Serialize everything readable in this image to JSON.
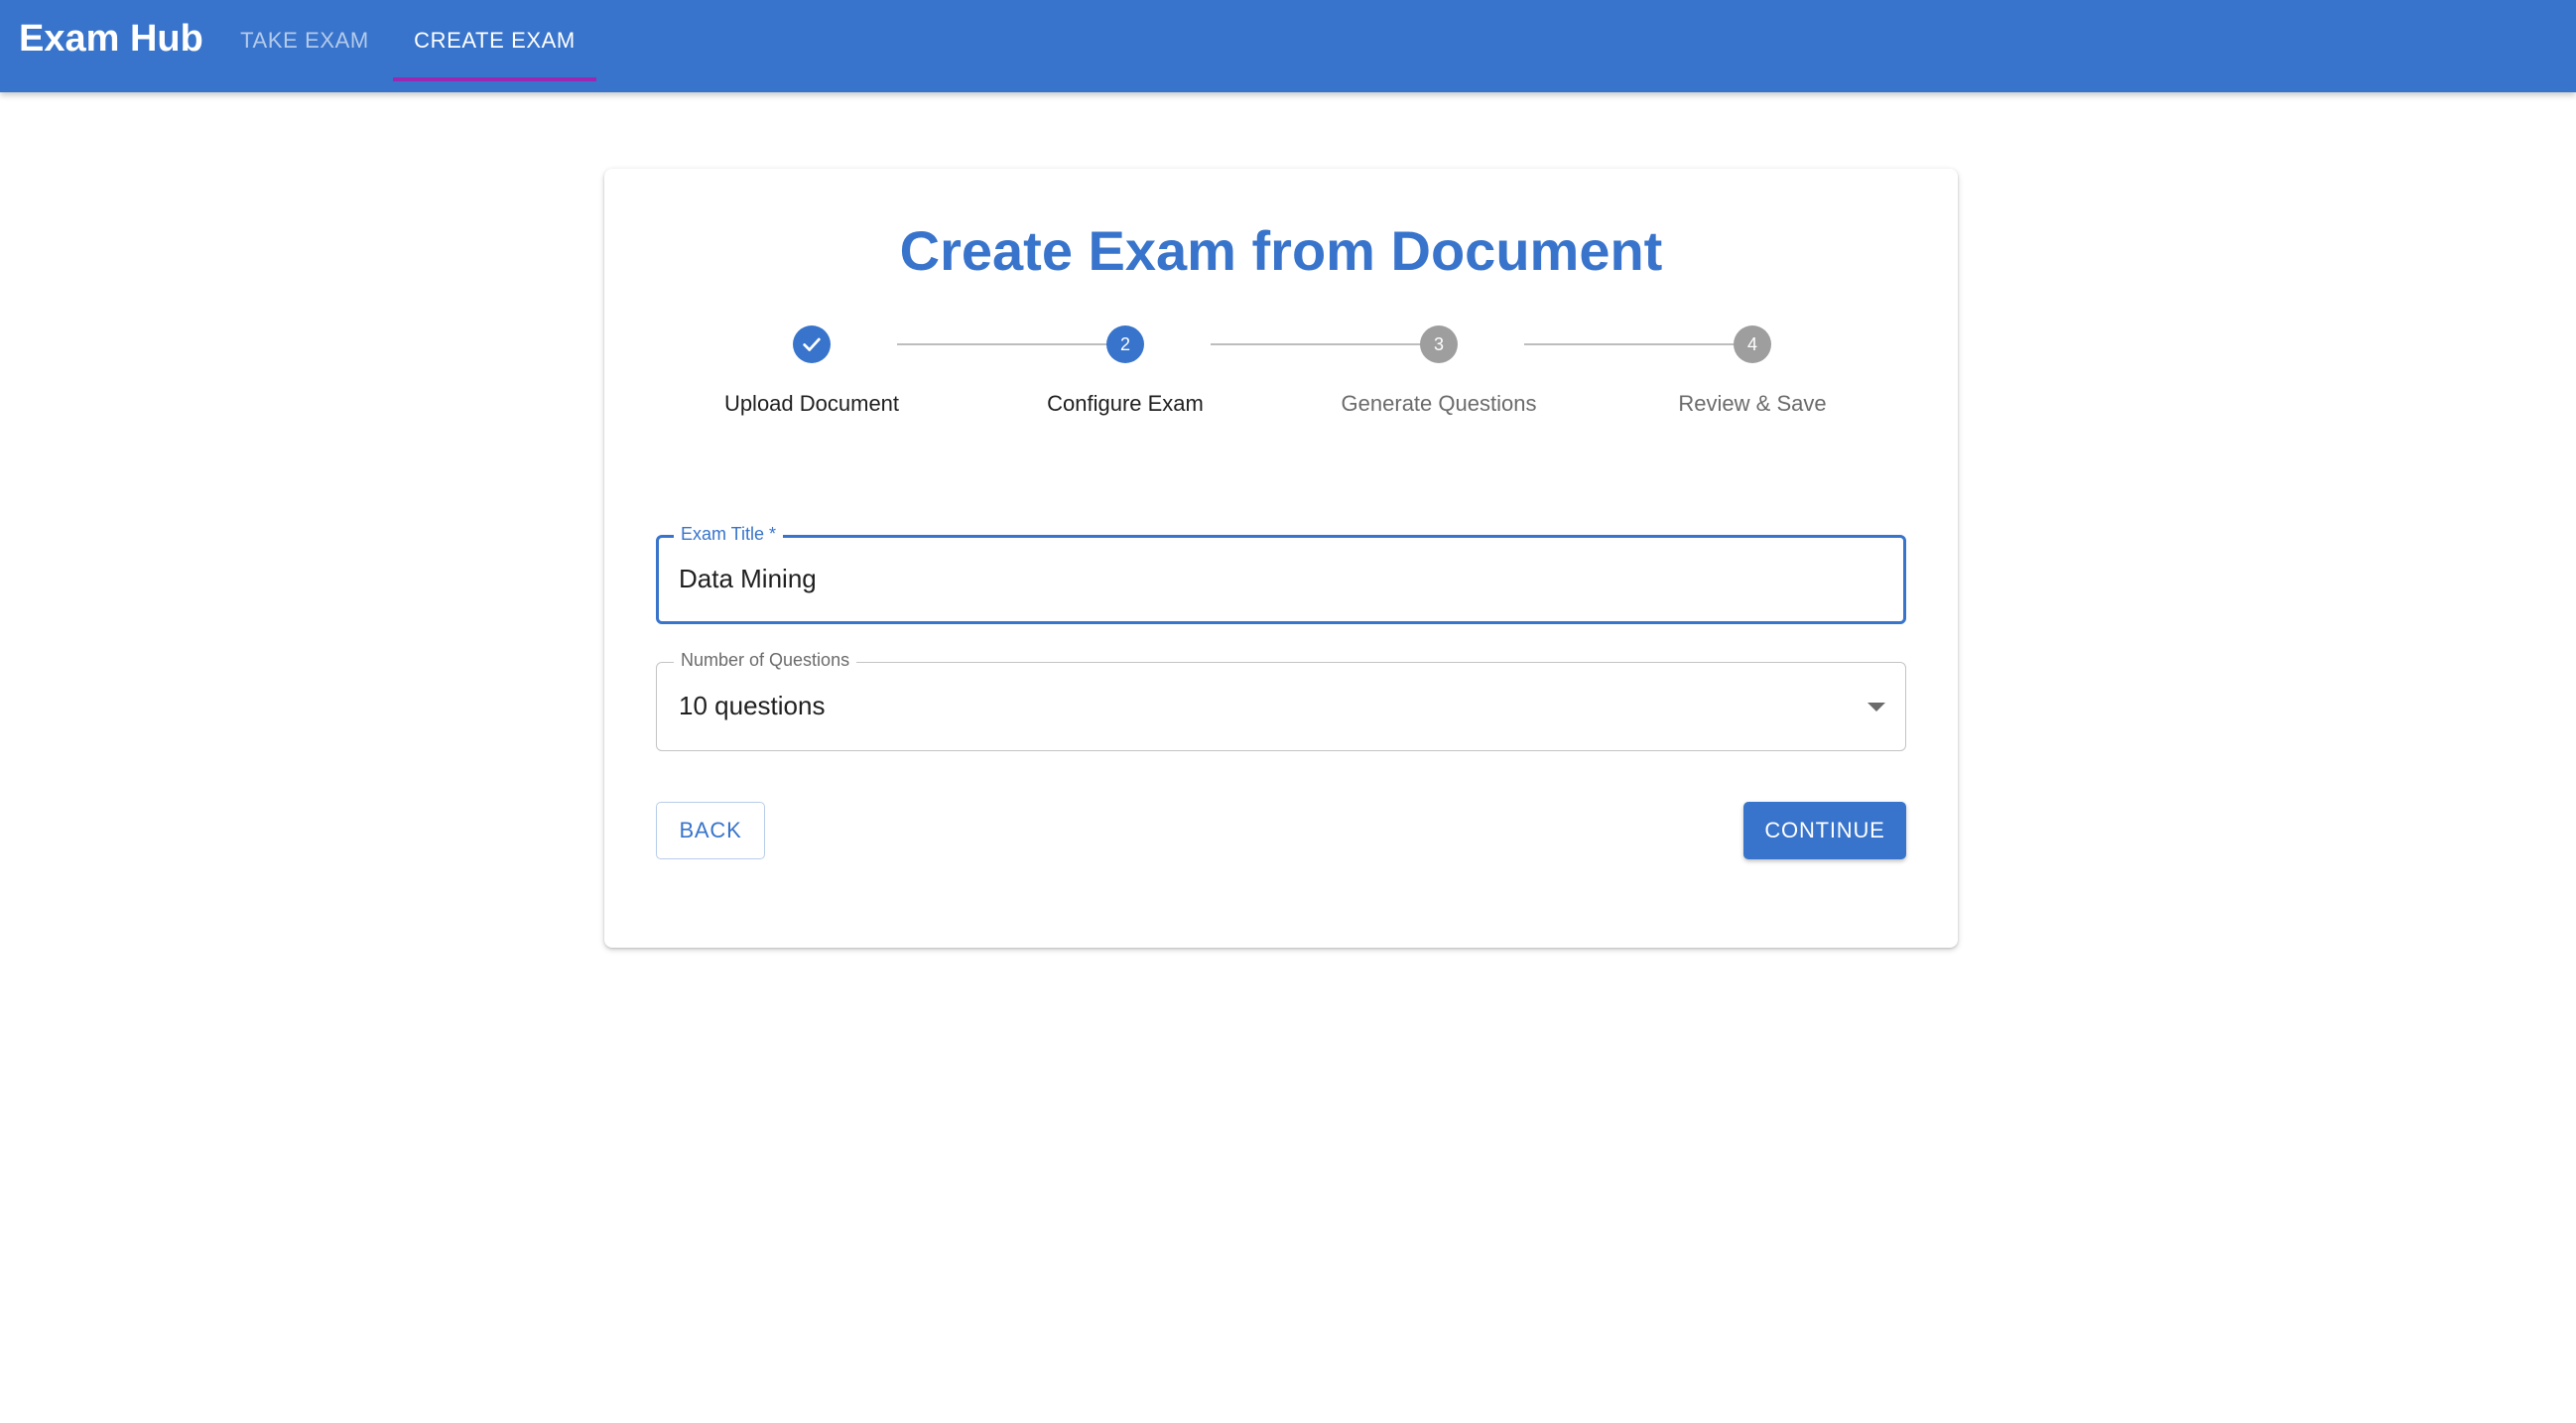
{
  "app": {
    "brand": "Exam Hub",
    "nav": {
      "take_exam": "TAKE EXAM",
      "create_exam": "CREATE EXAM",
      "active_tab": "CREATE EXAM"
    }
  },
  "card": {
    "title": "Create Exam from Document"
  },
  "stepper": {
    "steps": [
      {
        "label": "Upload Document",
        "number": "1",
        "status": "completed",
        "icon": "check-icon"
      },
      {
        "label": "Configure Exam",
        "number": "2",
        "status": "active"
      },
      {
        "label": "Generate Questions",
        "number": "3",
        "status": "pending"
      },
      {
        "label": "Review & Save",
        "number": "4",
        "status": "pending"
      }
    ]
  },
  "form": {
    "exam_title": {
      "label": "Exam Title *",
      "value": "Data Mining"
    },
    "num_questions": {
      "label": "Number of Questions",
      "value": "10 questions"
    }
  },
  "buttons": {
    "back": "BACK",
    "continue": "CONTINUE"
  },
  "colors": {
    "primary": "#3874cb",
    "tab_indicator": "#9c27b0",
    "pending_step": "#9e9e9e"
  }
}
